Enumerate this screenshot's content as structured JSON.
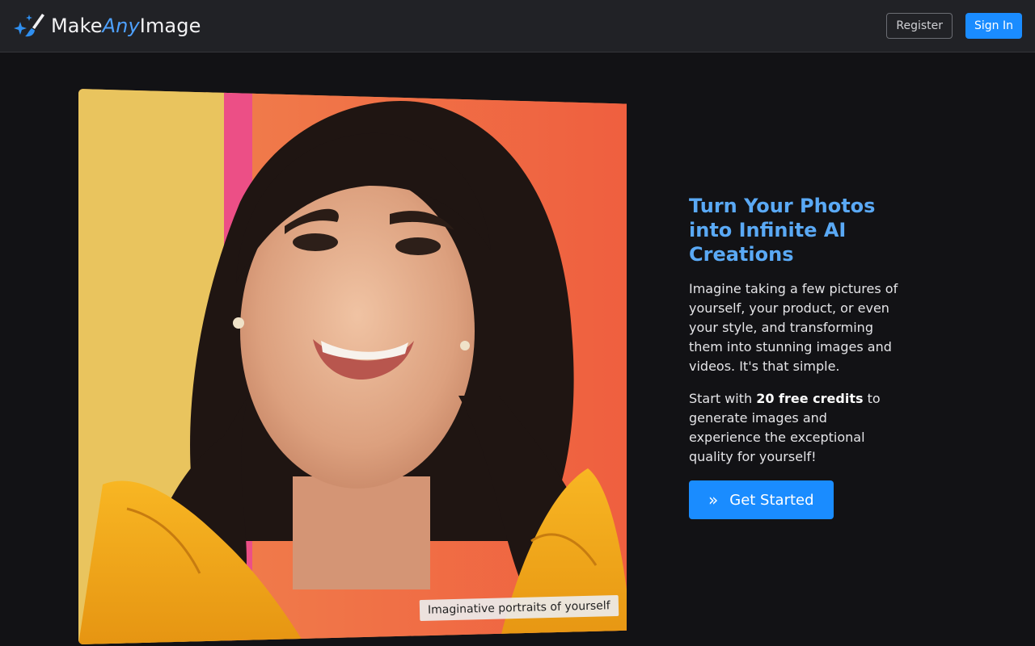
{
  "brand": {
    "prefix": "Make",
    "accent": "Any",
    "suffix": "Image",
    "icon": "magic-wand-sparkles-icon"
  },
  "nav": {
    "register_label": "Register",
    "signin_label": "Sign In"
  },
  "hero": {
    "image_subject": "portrait-photo",
    "caption": "Imaginative portraits of yourself",
    "title": "Turn Your Photos into Infinite AI Creations",
    "paragraph1": "Imagine taking a few pictures of yourself, your product, or even your style, and transforming them into stunning images and videos. It's that simple.",
    "p2_before": "Start with ",
    "p2_bold": "20 free credits",
    "p2_after": " to generate images and experience the exceptional quality for yourself!",
    "cta_icon": "»",
    "cta_label": "Get Started"
  },
  "colors": {
    "background": "#121215",
    "navbar": "#212226",
    "accent": "#1a8cff",
    "title": "#5aa9f5"
  }
}
